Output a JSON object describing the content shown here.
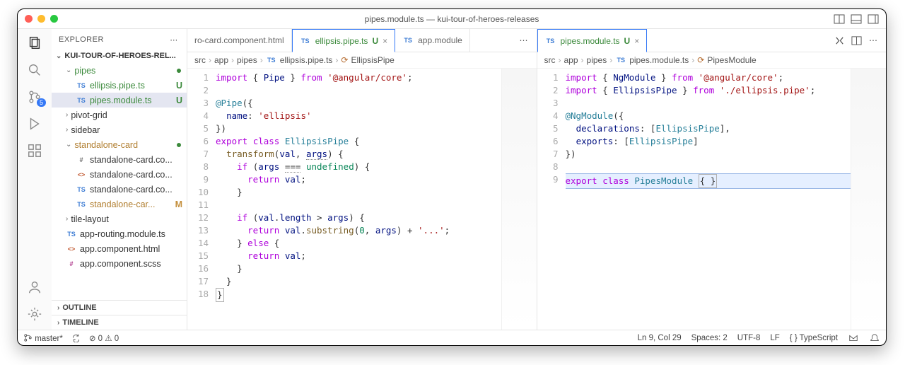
{
  "window": {
    "title": "pipes.module.ts — kui-tour-of-heroes-releases"
  },
  "sidebar": {
    "header": "EXPLORER",
    "section": "KUI-TOUR-OF-HEROES-REL...",
    "tree": [
      {
        "type": "folder",
        "name": "pipes",
        "git": "dot",
        "class": "green",
        "indent": 1,
        "open": true
      },
      {
        "type": "file",
        "icon": "TS",
        "name": "ellipsis.pipe.ts",
        "git": "U",
        "indent": 2
      },
      {
        "type": "file",
        "icon": "TS",
        "name": "pipes.module.ts",
        "git": "U",
        "indent": 2,
        "selected": true
      },
      {
        "type": "folder",
        "name": "pivot-grid",
        "indent": 1
      },
      {
        "type": "folder",
        "name": "sidebar",
        "indent": 1
      },
      {
        "type": "folder",
        "name": "standalone-card",
        "git": "dot",
        "class": "amber",
        "indent": 1,
        "open": true
      },
      {
        "type": "file",
        "icon": "#",
        "iconClass": "hash-badge",
        "name": "standalone-card.co...",
        "indent": 2
      },
      {
        "type": "file",
        "icon": "<>",
        "iconClass": "html-badge",
        "name": "standalone-card.co...",
        "indent": 2
      },
      {
        "type": "file",
        "icon": "TS",
        "name": "standalone-card.co...",
        "indent": 2
      },
      {
        "type": "file",
        "icon": "TS",
        "name": "standalone-car...",
        "git": "M",
        "indent": 2,
        "amber": true
      },
      {
        "type": "folder",
        "name": "tile-layout",
        "indent": 1
      },
      {
        "type": "file",
        "icon": "TS",
        "name": "app-routing.module.ts",
        "indent": 1
      },
      {
        "type": "file",
        "icon": "<>",
        "iconClass": "html-badge",
        "name": "app.component.html",
        "indent": 1
      },
      {
        "type": "file",
        "icon": "#",
        "iconClass": "scss-badge",
        "name": "app.component.scss",
        "indent": 1
      }
    ],
    "outline": "OUTLINE",
    "timeline": "TIMELINE"
  },
  "activity": {
    "scm_badge": "5"
  },
  "left_editor": {
    "tabs": [
      {
        "label": "ro-card.component.html",
        "icon": "",
        "active": false
      },
      {
        "label": "ellipsis.pipe.ts",
        "icon": "TS",
        "git": "U",
        "active": true,
        "close": true
      },
      {
        "label": "app.module",
        "icon": "TS",
        "active": false
      }
    ],
    "crumbs": [
      "src",
      "app",
      "pipes",
      "ellipsis.pipe.ts",
      "EllipsisPipe"
    ],
    "lines": 18
  },
  "right_editor": {
    "tabs": [
      {
        "label": "pipes.module.ts",
        "icon": "TS",
        "git": "U",
        "active": true,
        "close": true
      }
    ],
    "crumbs": [
      "src",
      "app",
      "pipes",
      "pipes.module.ts",
      "PipesModule"
    ],
    "lines": 9
  },
  "status": {
    "branch": "master*",
    "errors": "0",
    "warnings": "0",
    "lncol": "Ln 9, Col 29",
    "spaces": "Spaces: 2",
    "encoding": "UTF-8",
    "eol": "LF",
    "lang": "TypeScript"
  }
}
